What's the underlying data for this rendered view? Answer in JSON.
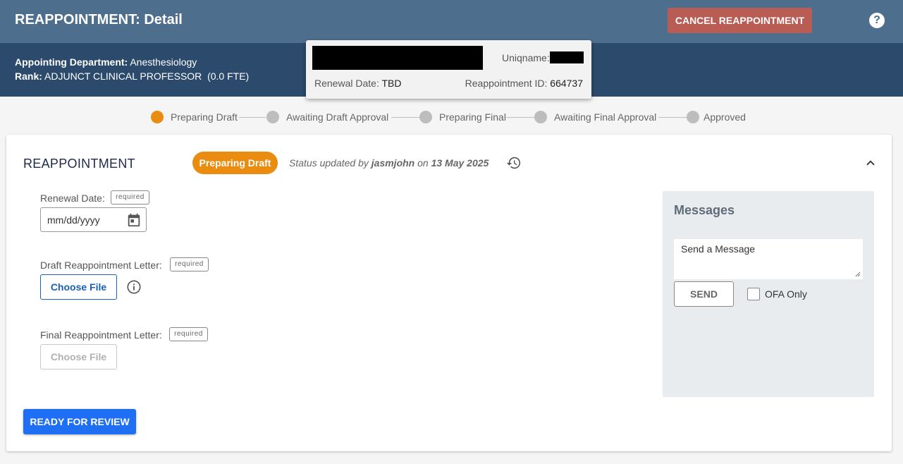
{
  "header": {
    "title": "REAPPOINTMENT: Detail",
    "cancel_label": "CANCEL REAPPOINTMENT",
    "help_icon": "?"
  },
  "info": {
    "department_label": "Appointing Department:",
    "department_value": "Anesthesiology",
    "rank_label": "Rank:",
    "rank_value": "ADJUNCT CLINICAL PROFESSOR  (0.0 FTE)"
  },
  "popover": {
    "uniqname_label": "Uniqname:",
    "renewal_label": "Renewal Date:",
    "renewal_value": "TBD",
    "id_label": "Reappointment ID:",
    "id_value": "664737"
  },
  "stepper": {
    "steps": [
      {
        "label": "Preparing Draft",
        "active": true
      },
      {
        "label": "Awaiting Draft Approval",
        "active": false
      },
      {
        "label": "Preparing Final",
        "active": false
      },
      {
        "label": "Awaiting Final Approval",
        "active": false
      },
      {
        "label": "Approved",
        "active": false
      }
    ]
  },
  "card": {
    "title": "REAPPOINTMENT",
    "status_pill": "Preparing Draft",
    "status_prefix": "Status updated by",
    "status_user": "jasmjohn",
    "status_on": "on",
    "status_date": "13 May 2025",
    "renewal_label": "Renewal Date:",
    "required_label": "required",
    "date_placeholder": "mm/dd/yyyy",
    "draft_letter_label": "Draft Reappointment Letter:",
    "final_letter_label": "Final Reappointment Letter:",
    "choose_file_label": "Choose File",
    "ready_label": "READY FOR REVIEW"
  },
  "messages": {
    "title": "Messages",
    "placeholder": "Send a Message",
    "send_label": "SEND",
    "ofa_label": "OFA Only"
  },
  "colors": {
    "header_bg": "#4e6e8e",
    "info_bg": "#2c4a6b",
    "status_orange": "#e98c0f",
    "primary_blue": "#1f6ff5",
    "cancel_red": "#b85c54"
  }
}
